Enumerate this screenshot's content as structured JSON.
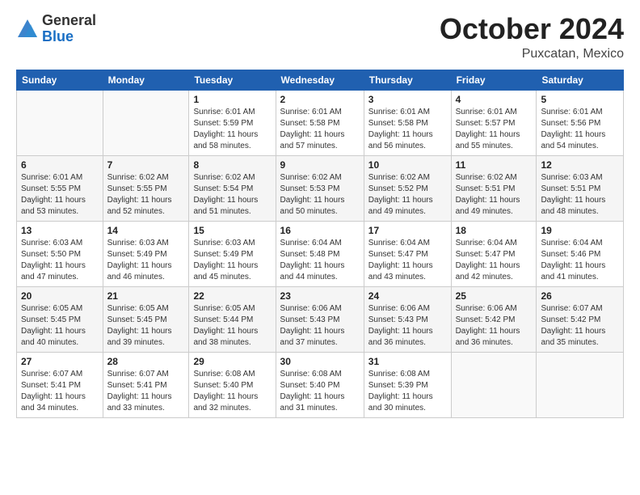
{
  "logo": {
    "general": "General",
    "blue": "Blue"
  },
  "title": "October 2024",
  "location": "Puxcatan, Mexico",
  "headers": [
    "Sunday",
    "Monday",
    "Tuesday",
    "Wednesday",
    "Thursday",
    "Friday",
    "Saturday"
  ],
  "weeks": [
    [
      {
        "day": "",
        "detail": ""
      },
      {
        "day": "",
        "detail": ""
      },
      {
        "day": "1",
        "detail": "Sunrise: 6:01 AM\nSunset: 5:59 PM\nDaylight: 11 hours and 58 minutes."
      },
      {
        "day": "2",
        "detail": "Sunrise: 6:01 AM\nSunset: 5:58 PM\nDaylight: 11 hours and 57 minutes."
      },
      {
        "day": "3",
        "detail": "Sunrise: 6:01 AM\nSunset: 5:58 PM\nDaylight: 11 hours and 56 minutes."
      },
      {
        "day": "4",
        "detail": "Sunrise: 6:01 AM\nSunset: 5:57 PM\nDaylight: 11 hours and 55 minutes."
      },
      {
        "day": "5",
        "detail": "Sunrise: 6:01 AM\nSunset: 5:56 PM\nDaylight: 11 hours and 54 minutes."
      }
    ],
    [
      {
        "day": "6",
        "detail": "Sunrise: 6:01 AM\nSunset: 5:55 PM\nDaylight: 11 hours and 53 minutes."
      },
      {
        "day": "7",
        "detail": "Sunrise: 6:02 AM\nSunset: 5:55 PM\nDaylight: 11 hours and 52 minutes."
      },
      {
        "day": "8",
        "detail": "Sunrise: 6:02 AM\nSunset: 5:54 PM\nDaylight: 11 hours and 51 minutes."
      },
      {
        "day": "9",
        "detail": "Sunrise: 6:02 AM\nSunset: 5:53 PM\nDaylight: 11 hours and 50 minutes."
      },
      {
        "day": "10",
        "detail": "Sunrise: 6:02 AM\nSunset: 5:52 PM\nDaylight: 11 hours and 49 minutes."
      },
      {
        "day": "11",
        "detail": "Sunrise: 6:02 AM\nSunset: 5:51 PM\nDaylight: 11 hours and 49 minutes."
      },
      {
        "day": "12",
        "detail": "Sunrise: 6:03 AM\nSunset: 5:51 PM\nDaylight: 11 hours and 48 minutes."
      }
    ],
    [
      {
        "day": "13",
        "detail": "Sunrise: 6:03 AM\nSunset: 5:50 PM\nDaylight: 11 hours and 47 minutes."
      },
      {
        "day": "14",
        "detail": "Sunrise: 6:03 AM\nSunset: 5:49 PM\nDaylight: 11 hours and 46 minutes."
      },
      {
        "day": "15",
        "detail": "Sunrise: 6:03 AM\nSunset: 5:49 PM\nDaylight: 11 hours and 45 minutes."
      },
      {
        "day": "16",
        "detail": "Sunrise: 6:04 AM\nSunset: 5:48 PM\nDaylight: 11 hours and 44 minutes."
      },
      {
        "day": "17",
        "detail": "Sunrise: 6:04 AM\nSunset: 5:47 PM\nDaylight: 11 hours and 43 minutes."
      },
      {
        "day": "18",
        "detail": "Sunrise: 6:04 AM\nSunset: 5:47 PM\nDaylight: 11 hours and 42 minutes."
      },
      {
        "day": "19",
        "detail": "Sunrise: 6:04 AM\nSunset: 5:46 PM\nDaylight: 11 hours and 41 minutes."
      }
    ],
    [
      {
        "day": "20",
        "detail": "Sunrise: 6:05 AM\nSunset: 5:45 PM\nDaylight: 11 hours and 40 minutes."
      },
      {
        "day": "21",
        "detail": "Sunrise: 6:05 AM\nSunset: 5:45 PM\nDaylight: 11 hours and 39 minutes."
      },
      {
        "day": "22",
        "detail": "Sunrise: 6:05 AM\nSunset: 5:44 PM\nDaylight: 11 hours and 38 minutes."
      },
      {
        "day": "23",
        "detail": "Sunrise: 6:06 AM\nSunset: 5:43 PM\nDaylight: 11 hours and 37 minutes."
      },
      {
        "day": "24",
        "detail": "Sunrise: 6:06 AM\nSunset: 5:43 PM\nDaylight: 11 hours and 36 minutes."
      },
      {
        "day": "25",
        "detail": "Sunrise: 6:06 AM\nSunset: 5:42 PM\nDaylight: 11 hours and 36 minutes."
      },
      {
        "day": "26",
        "detail": "Sunrise: 6:07 AM\nSunset: 5:42 PM\nDaylight: 11 hours and 35 minutes."
      }
    ],
    [
      {
        "day": "27",
        "detail": "Sunrise: 6:07 AM\nSunset: 5:41 PM\nDaylight: 11 hours and 34 minutes."
      },
      {
        "day": "28",
        "detail": "Sunrise: 6:07 AM\nSunset: 5:41 PM\nDaylight: 11 hours and 33 minutes."
      },
      {
        "day": "29",
        "detail": "Sunrise: 6:08 AM\nSunset: 5:40 PM\nDaylight: 11 hours and 32 minutes."
      },
      {
        "day": "30",
        "detail": "Sunrise: 6:08 AM\nSunset: 5:40 PM\nDaylight: 11 hours and 31 minutes."
      },
      {
        "day": "31",
        "detail": "Sunrise: 6:08 AM\nSunset: 5:39 PM\nDaylight: 11 hours and 30 minutes."
      },
      {
        "day": "",
        "detail": ""
      },
      {
        "day": "",
        "detail": ""
      }
    ]
  ]
}
